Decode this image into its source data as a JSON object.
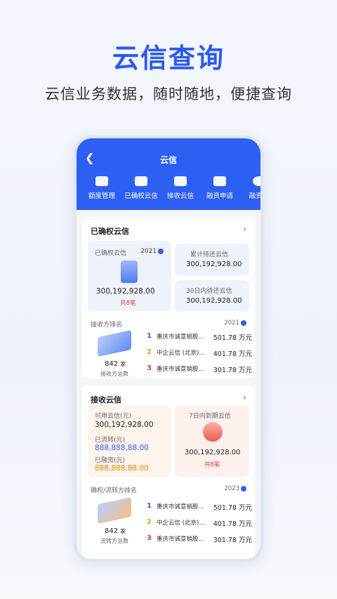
{
  "hero": {
    "title": "云信查询",
    "subtitle": "云信业务数据，随时随地，便捷查询"
  },
  "app": {
    "title": "云信",
    "back_icon": "chevron-left-icon"
  },
  "tabs": [
    {
      "label": "额度管理"
    },
    {
      "label": "已确权云信"
    },
    {
      "label": "接收云信"
    },
    {
      "label": "融资申请"
    },
    {
      "label": "融资管"
    }
  ],
  "card1": {
    "title": "已确权云信",
    "main": {
      "label": "已确权云信",
      "year": "2021",
      "amount": "300,192,928.00",
      "count": "共8笔"
    },
    "side1": {
      "label": "累计待还云信",
      "amount": "300,192,928.00"
    },
    "side2": {
      "label": "30日内待还云信",
      "amount": "300,192,928.00"
    },
    "ranking": {
      "label": "接收方排名",
      "year": "2021",
      "total": "842",
      "unit": "家",
      "total_label": "接收方总数",
      "rows": [
        {
          "rank": "1",
          "name": "重庆市诚意销股...",
          "value": "501.78 万元"
        },
        {
          "rank": "2",
          "name": "中企云信 (北京)...",
          "value": "401.78 万元"
        },
        {
          "rank": "3",
          "name": "重庆市诚意销股...",
          "value": "301.78 万元"
        }
      ]
    }
  },
  "card2": {
    "title": "接收云信",
    "avail": {
      "label": "可用云信(元)",
      "amount": "300,192,928.00",
      "flow_label": "已流转(元)",
      "flow_amount": "888,888,88.00",
      "fin_label": "已融资(元)",
      "fin_amount": "888,888,88.00"
    },
    "expire": {
      "label": "7日内到期云信",
      "amount": "300,192,928.00",
      "count": "共8笔"
    },
    "ranking": {
      "label": "确权/流转方排名",
      "year": "2023",
      "total": "842",
      "unit": "家",
      "total_label": "流转方总数",
      "rows": [
        {
          "rank": "1",
          "name": "重庆市诚意销股...",
          "value": "501.78 万元"
        },
        {
          "rank": "2",
          "name": "中企云信 (北京)...",
          "value": "401.78 万元"
        },
        {
          "rank": "3",
          "name": "重庆市诚意销股...",
          "value": "301.78 万元"
        }
      ]
    }
  },
  "colors": {
    "primary": "#2d5ff3",
    "rank1": "#2d5ff3",
    "rank2": "#f0a020",
    "rank3": "#e23b3b",
    "orange": "#e88a00"
  }
}
